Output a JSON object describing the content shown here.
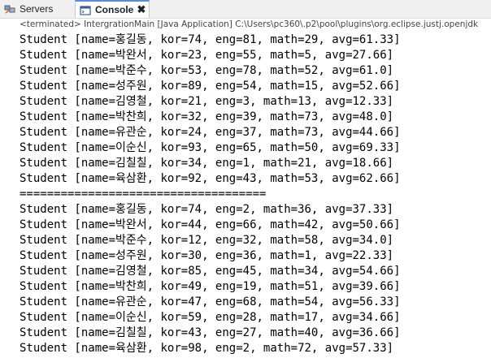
{
  "tabs": [
    {
      "label": "Servers",
      "icon": "servers-icon"
    },
    {
      "label": "Console",
      "icon": "console-icon",
      "active": true,
      "close_glyph": "✖"
    }
  ],
  "status": "<terminated> IntergrationMain [Java Application] C:\\Users\\pc360\\.p2\\pool\\plugins\\org.eclipse.justj.openjdk",
  "output_lines": [
    "Student [name=홍길동, kor=74, eng=81, math=29, avg=61.33]",
    "Student [name=박완서, kor=23, eng=55, math=5, avg=27.66]",
    "Student [name=박준수, kor=53, eng=78, math=52, avg=61.0]",
    "Student [name=성주원, kor=89, eng=54, math=15, avg=52.66]",
    "Student [name=김영철, kor=21, eng=3, math=13, avg=12.33]",
    "Student [name=박찬희, kor=32, eng=39, math=73, avg=48.0]",
    "Student [name=유관순, kor=24, eng=37, math=73, avg=44.66]",
    "Student [name=이순신, kor=93, eng=65, math=50, avg=69.33]",
    "Student [name=김칠칠, kor=34, eng=1, math=21, avg=18.66]",
    "Student [name=육삼환, kor=92, eng=43, math=53, avg=62.66]",
    "====================================",
    "Student [name=홍길동, kor=74, eng=2, math=36, avg=37.33]",
    "Student [name=박완서, kor=44, eng=66, math=42, avg=50.66]",
    "Student [name=박준수, kor=12, eng=32, math=58, avg=34.0]",
    "Student [name=성주원, kor=30, eng=36, math=1, avg=22.33]",
    "Student [name=김영철, kor=85, eng=45, math=34, avg=54.66]",
    "Student [name=박찬희, kor=49, eng=19, math=51, avg=39.66]",
    "Student [name=유관순, kor=47, eng=68, math=54, avg=56.33]",
    "Student [name=이순신, kor=59, eng=28, math=17, avg=34.66]",
    "Student [name=김칠칠, kor=43, eng=27, math=40, avg=36.66]",
    "Student [name=육삼환, kor=98, eng=2, math=72, avg=57.33]"
  ]
}
